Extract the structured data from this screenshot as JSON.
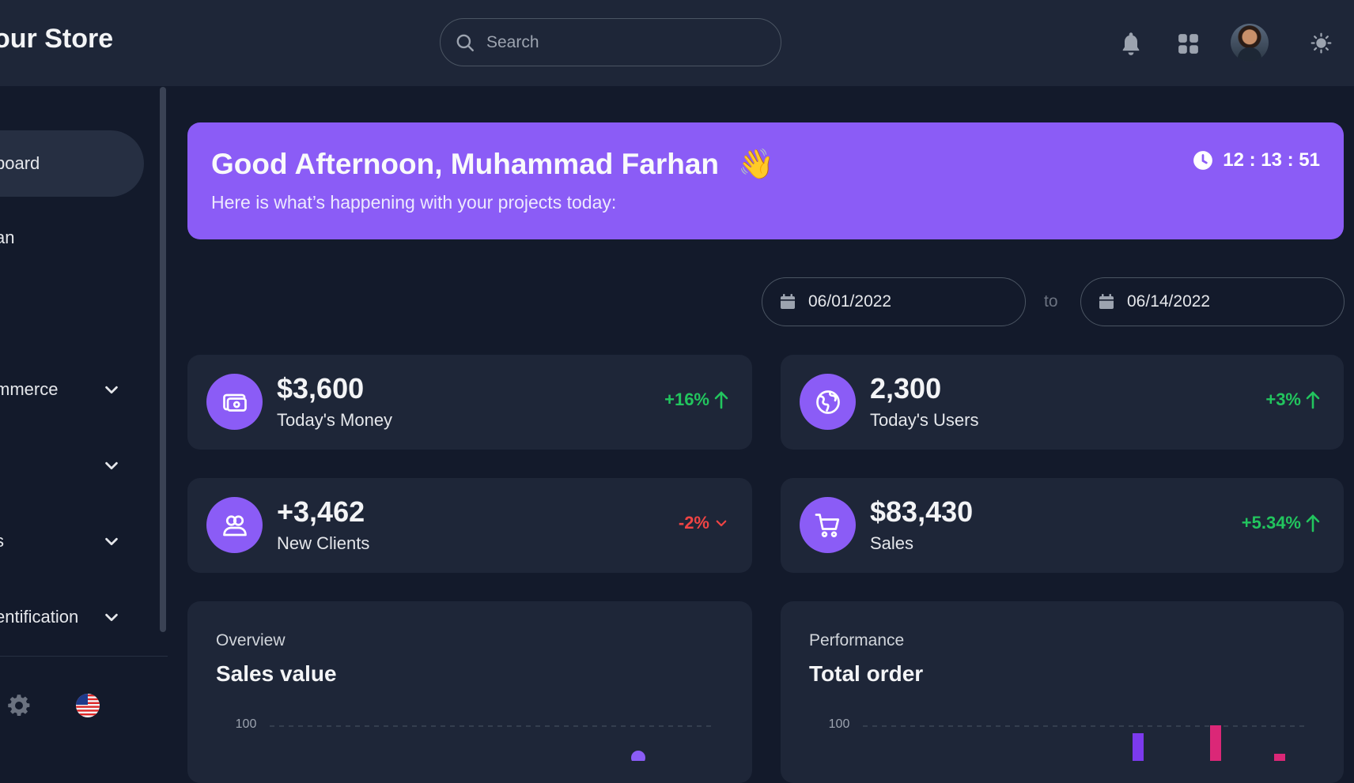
{
  "header": {
    "brand": "our Store",
    "search_placeholder": "Search"
  },
  "sidebar": {
    "items": [
      {
        "label": "board",
        "active": true,
        "has_chevron": false
      },
      {
        "label": "an",
        "active": false,
        "has_chevron": false
      },
      {
        "label": "mmerce",
        "active": false,
        "has_chevron": true
      },
      {
        "label": "",
        "active": false,
        "has_chevron": true
      },
      {
        "label": "s",
        "active": false,
        "has_chevron": true
      },
      {
        "label": "entification",
        "active": false,
        "has_chevron": true
      }
    ]
  },
  "hero": {
    "greeting": "Good Afternoon, Muhammad Farhan",
    "wave_emoji": "👋",
    "subtitle": "Here is what’s happening with your projects today:",
    "time": "12 : 13 : 51"
  },
  "date_range": {
    "from": "06/01/2022",
    "separator": "to",
    "to": "06/14/2022"
  },
  "stats": [
    {
      "value": "$3,600",
      "label": "Today's Money",
      "change": "+16%",
      "direction": "up",
      "icon": "money-icon"
    },
    {
      "value": "2,300",
      "label": "Today's Users",
      "change": "+3%",
      "direction": "up",
      "icon": "globe-icon"
    },
    {
      "value": "+3,462",
      "label": "New Clients",
      "change": "-2%",
      "direction": "down",
      "icon": "users-icon"
    },
    {
      "value": "$83,430",
      "label": "Sales",
      "change": "+5.34%",
      "direction": "up",
      "icon": "cart-icon"
    }
  ],
  "panels": [
    {
      "kicker": "Overview",
      "title": "Sales value",
      "tick": "100"
    },
    {
      "kicker": "Performance",
      "title": "Total order",
      "tick": "100"
    }
  ],
  "colors": {
    "accent": "#8b5cf6",
    "positive": "#22c55e",
    "negative": "#ef4444",
    "bar_secondary": "#db2777"
  }
}
